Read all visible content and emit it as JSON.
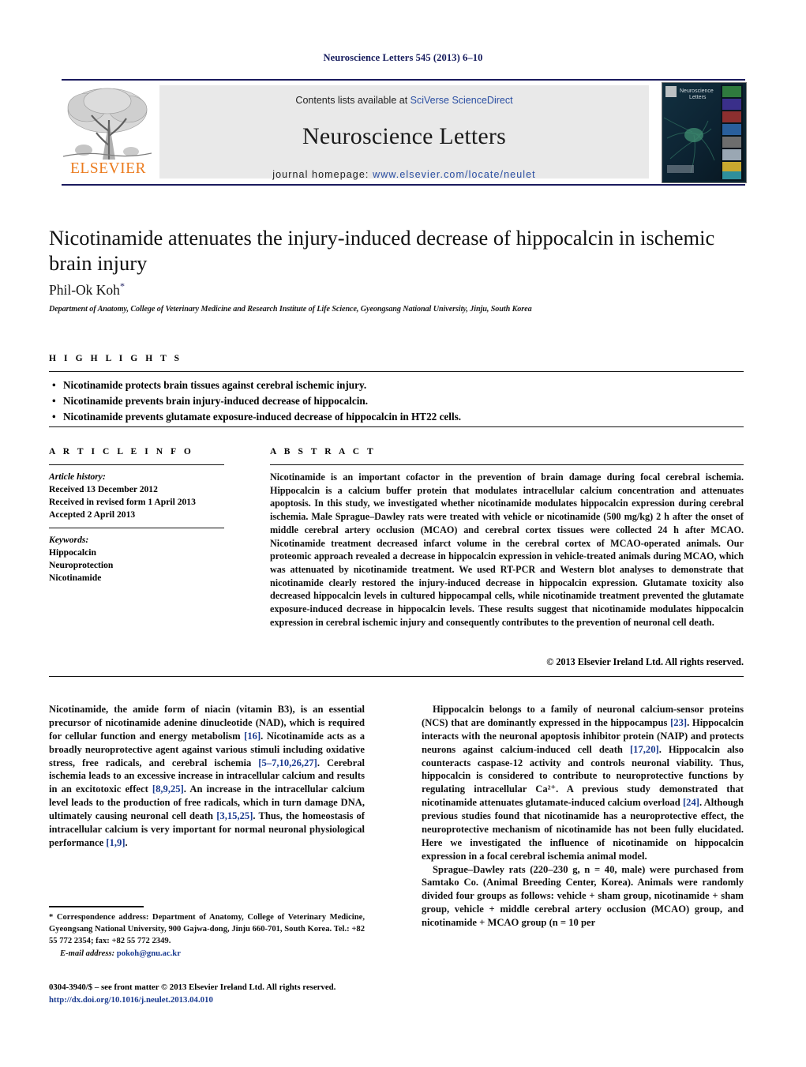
{
  "running_head": "Neuroscience Letters 545 (2013) 6–10",
  "masthead": {
    "contents_prefix": "Contents lists available at ",
    "contents_link": "SciVerse ScienceDirect",
    "journal_name": "Neuroscience Letters",
    "homepage_prefix": "journal homepage: ",
    "homepage_url": "www.elsevier.com/locate/neulet",
    "publisher_wordmark": "ELSEVIER",
    "cover_title_line1": "Neuroscience",
    "cover_title_line2": "Letters",
    "colors": {
      "rule": "#1a1a5e",
      "link": "#2a4ea2",
      "elsevier_orange": "#eb7b1e",
      "band_gray": "#e9e9e9"
    }
  },
  "article": {
    "title": "Nicotinamide attenuates the injury-induced decrease of hippocalcin in ischemic brain injury",
    "author": "Phil-Ok Koh",
    "author_marker": "*",
    "affiliation": "Department of Anatomy, College of Veterinary Medicine and Research Institute of Life Science, Gyeongsang National University, Jinju, South Korea"
  },
  "highlights": {
    "label": "H I G H L I G H T S",
    "bullet_glyph": "•",
    "items": [
      "Nicotinamide protects brain tissues against cerebral ischemic injury.",
      "Nicotinamide prevents brain injury-induced decrease of hippocalcin.",
      "Nicotinamide prevents glutamate exposure-induced decrease of hippocalcin in HT22 cells."
    ]
  },
  "article_info": {
    "label": "A R T I C L E    I N F O",
    "history_label": "Article history:",
    "history": [
      "Received 13 December 2012",
      "Received in revised form 1 April 2013",
      "Accepted 2 April 2013"
    ],
    "keywords_label": "Keywords:",
    "keywords": [
      "Hippocalcin",
      "Neuroprotection",
      "Nicotinamide"
    ]
  },
  "abstract": {
    "label": "A B S T R A C T",
    "text": "Nicotinamide is an important cofactor in the prevention of brain damage during focal cerebral ischemia. Hippocalcin is a calcium buffer protein that modulates intracellular calcium concentration and attenuates apoptosis. In this study, we investigated whether nicotinamide modulates hippocalcin expression during cerebral ischemia. Male Sprague–Dawley rats were treated with vehicle or nicotinamide (500 mg/kg) 2 h after the onset of middle cerebral artery occlusion (MCAO) and cerebral cortex tissues were collected 24 h after MCAO. Nicotinamide treatment decreased infarct volume in the cerebral cortex of MCAO-operated animals. Our proteomic approach revealed a decrease in hippocalcin expression in vehicle-treated animals during MCAO, which was attenuated by nicotinamide treatment. We used RT-PCR and Western blot analyses to demonstrate that nicotinamide clearly restored the injury-induced decrease in hippocalcin expression. Glutamate toxicity also decreased hippocalcin levels in cultured hippocampal cells, while nicotinamide treatment prevented the glutamate exposure-induced decrease in hippocalcin levels. These results suggest that nicotinamide modulates hippocalcin expression in cerebral ischemic injury and consequently contributes to the prevention of neuronal cell death.",
    "copyright": "© 2013 Elsevier Ireland Ltd. All rights reserved."
  },
  "body": {
    "left_paragraph_parts": [
      {
        "t": "Nicotinamide, the amide form of niacin (vitamin B3), is an essential precursor of nicotinamide adenine dinucleotide (NAD), which is required for cellular function and energy metabolism "
      },
      {
        "t": "[16]",
        "ref": true
      },
      {
        "t": ". Nicotinamide acts as a broadly neuroprotective agent against various stimuli including oxidative stress, free radicals, and cerebral ischemia "
      },
      {
        "t": "[5–7,10,26,27]",
        "ref": true
      },
      {
        "t": ". Cerebral ischemia leads to an excessive increase in intracellular calcium and results in an excitotoxic effect "
      },
      {
        "t": "[8,9,25]",
        "ref": true
      },
      {
        "t": ". An increase in the intracellular calcium level leads to the production of free radicals, which in turn damage DNA, ultimately causing neuronal cell death "
      },
      {
        "t": "[3,15,25]",
        "ref": true
      },
      {
        "t": ". Thus, the homeostasis of intracellular calcium is very important for normal neuronal physiological performance "
      },
      {
        "t": "[1,9]",
        "ref": true
      },
      {
        "t": "."
      }
    ],
    "right_paragraph1_parts": [
      {
        "t": "Hippocalcin belongs to a family of neuronal calcium-sensor proteins (NCS) that are dominantly expressed in the hippocampus "
      },
      {
        "t": "[23]",
        "ref": true
      },
      {
        "t": ". Hippocalcin interacts with the neuronal apoptosis inhibitor protein (NAIP) and protects neurons against calcium-induced cell death "
      },
      {
        "t": "[17,20]",
        "ref": true
      },
      {
        "t": ". Hippocalcin also counteracts caspase-12 activity and controls neuronal viability. Thus, hippocalcin is considered to contribute to neuroprotective functions by regulating intracellular Ca²⁺. A previous study demonstrated that nicotinamide attenuates glutamate-induced calcium overload "
      },
      {
        "t": "[24]",
        "ref": true
      },
      {
        "t": ". Although previous studies found that nicotinamide has a neuroprotective effect, the neuroprotective mechanism of nicotinamide has not been fully elucidated. Here we investigated the influence of nicotinamide on hippocalcin expression in a focal cerebral ischemia animal model."
      }
    ],
    "right_paragraph2_parts": [
      {
        "t": "Sprague–Dawley rats (220–230 g, n = 40, male) were purchased from Samtako Co. (Animal Breeding Center, Korea). Animals were randomly divided four groups as follows: vehicle + sham group, nicotinamide + sham group, vehicle + middle cerebral artery occlusion (MCAO) group, and nicotinamide + MCAO group (n = 10 per"
      }
    ]
  },
  "footnotes": {
    "correspondence_marker": "*",
    "correspondence": " Correspondence address: Department of Anatomy, College of Veterinary Medicine, Gyeongsang National University, 900 Gajwa-dong, Jinju 660-701, South Korea. Tel.: +82 55 772 2354; fax: +82 55 772 2349.",
    "email_label": "E-mail address:",
    "email": "pokoh@gnu.ac.kr",
    "issn_line": "0304-3940/$ – see front matter © 2013 Elsevier Ireland Ltd. All rights reserved.",
    "doi": "http://dx.doi.org/10.1016/j.neulet.2013.04.010"
  }
}
